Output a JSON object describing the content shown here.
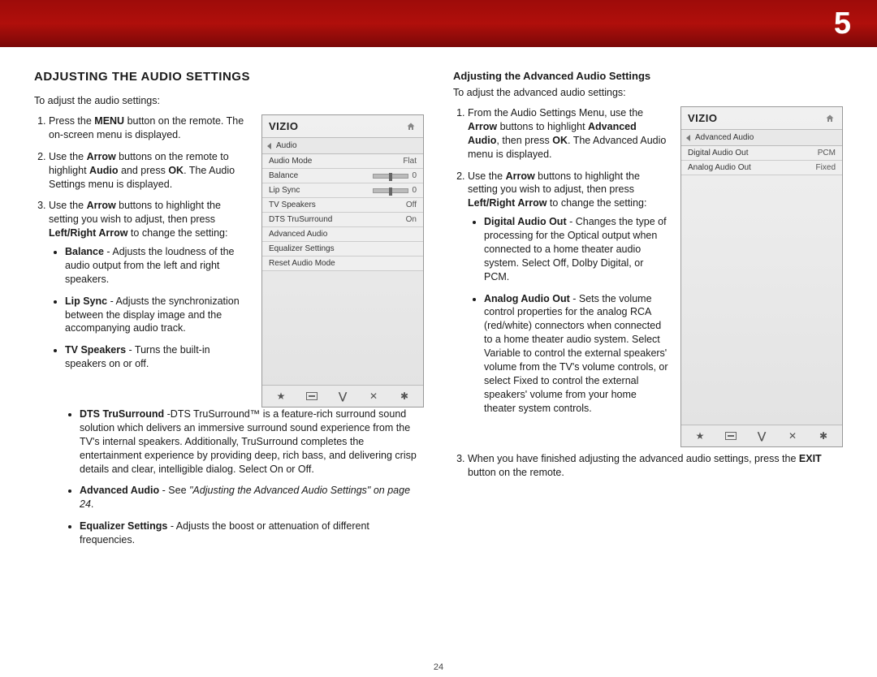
{
  "banner": {
    "chapter": "5"
  },
  "page_number": "24",
  "left": {
    "heading": "ADJUSTING THE AUDIO SETTINGS",
    "intro": "To adjust the audio settings:",
    "step1_a": "Press the ",
    "step1_b": "MENU",
    "step1_c": " button on the remote. The on-screen menu is displayed.",
    "step2_a": "Use the ",
    "step2_b": "Arrow",
    "step2_c": " buttons on the remote to highlight ",
    "step2_d": "Audio",
    "step2_e": " and press ",
    "step2_f": "OK",
    "step2_g": ". The Audio Settings menu is displayed.",
    "step3_a": "Use the ",
    "step3_b": "Arrow",
    "step3_c": " buttons to highlight the setting you wish to adjust, then press ",
    "step3_d": "Left/Right Arrow",
    "step3_e": " to change the setting:",
    "bullets_narrow": {
      "balance_t": "Balance",
      "balance_d": " - Adjusts the loudness of the audio output from the left and right speakers.",
      "lip_t": "Lip Sync",
      "lip_d": " - Adjusts the syn­chronization between the display image and the accompanying audio track.",
      "spk_t": "TV Speakers",
      "spk_d": " - Turns the built-in speakers on or off."
    },
    "bullets_wide": {
      "dts_t": "DTS TruSurround",
      "dts_d": " -DTS TruSurround™ is a feature-rich surround sound solution which delivers an immersive surround sound experience from the TV's internal speakers.  Additionally, TruSurround completes the entertainment experience by providing deep, rich bass, and delivering crisp details and clear, intelligible dialog. Select On or Off.",
      "adv_t": "Advanced Audio",
      "adv_d1": " - See  ",
      "adv_d2": "\"Adjusting the Advanced Audio Settings\" on page 24",
      "adv_d3": ".",
      "eq_t": "Equalizer Settings",
      "eq_d": " - Adjusts the boost or attenuation of different frequencies."
    },
    "osd": {
      "logo": "VIZIO",
      "crumb": "Audio",
      "rows": [
        {
          "label": "Audio Mode",
          "value": "Flat",
          "type": "text"
        },
        {
          "label": "Balance",
          "value": "0",
          "type": "slider"
        },
        {
          "label": "Lip Sync",
          "value": "0",
          "type": "slider"
        },
        {
          "label": "TV Speakers",
          "value": "Off",
          "type": "text"
        },
        {
          "label": "DTS TruSurround",
          "value": "On",
          "type": "text"
        },
        {
          "label": "Advanced Audio",
          "value": "",
          "type": "text"
        },
        {
          "label": "Equalizer Settings",
          "value": "",
          "type": "text"
        },
        {
          "label": "Reset Audio Mode",
          "value": "",
          "type": "text"
        }
      ]
    }
  },
  "right": {
    "heading": "Adjusting the Advanced Audio Settings",
    "intro": "To adjust the advanced audio settings:",
    "step1_a": "From the Audio Settings Menu, use the ",
    "step1_b": "Arrow",
    "step1_c": " buttons to highlight ",
    "step1_d": "Advanced Audio",
    "step1_e": ", then press ",
    "step1_f": "OK",
    "step1_g": ". The Advanced Audio menu is displayed.",
    "step2_a": "Use the ",
    "step2_b": "Arrow",
    "step2_c": " buttons to highlight the setting you wish to adjust, then press ",
    "step2_d": "Left/Right Arrow",
    "step2_e": " to change the setting:",
    "bullets": {
      "dig_t": "Digital Audio Out",
      "dig_d": " - Changes the type of processing for the Optical output when connected to a home theater audio system. Select Off, Dolby Digital, or PCM.",
      "ana_t": "Analog Audio Out",
      "ana_d": " - Sets the volume control properties for the analog RCA (red/white) connectors when connected to a home theater audio system. Select Variable to control the external speakers' volume from the TV's volume controls, or select Fixed to control the external speakers' volume from your home theater system controls."
    },
    "step3_a": "When you have finished adjusting the advanced audio settings, press the ",
    "step3_b": "EXIT",
    "step3_c": " button on the remote.",
    "osd": {
      "logo": "VIZIO",
      "crumb": "Advanced Audio",
      "rows": [
        {
          "label": "Digital Audio Out",
          "value": "PCM"
        },
        {
          "label": "Analog Audio Out",
          "value": "Fixed"
        }
      ]
    }
  }
}
